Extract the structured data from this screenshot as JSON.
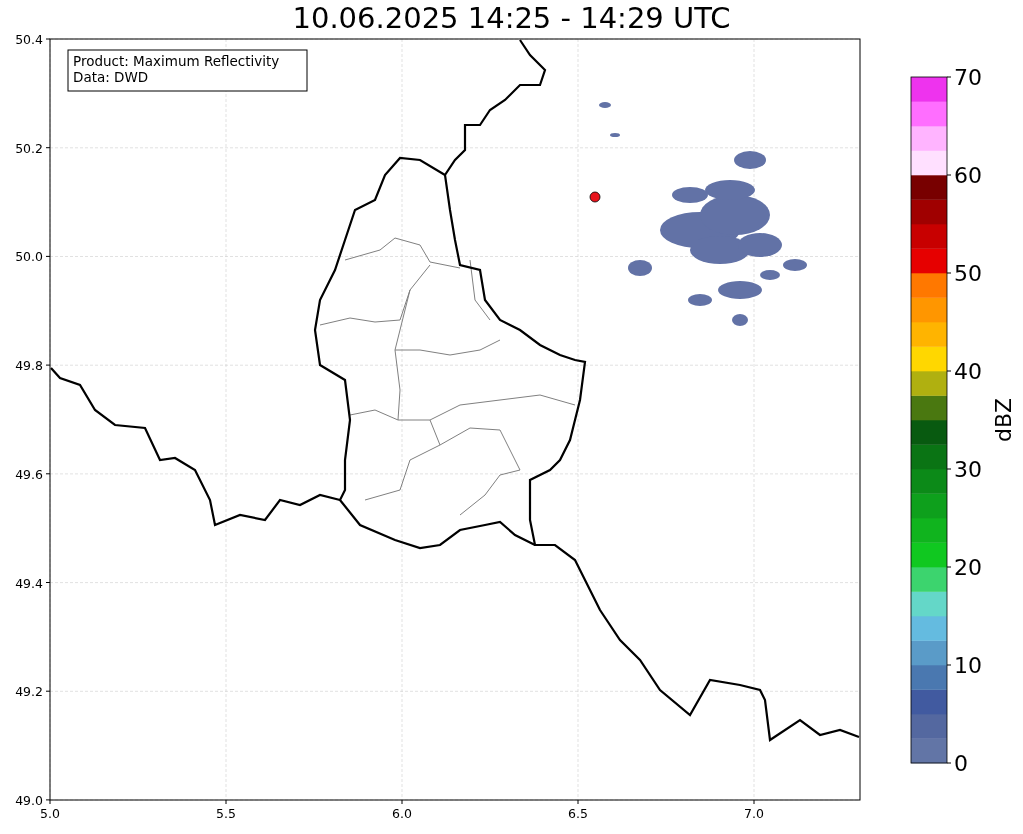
{
  "title": "10.06.2025 14:25 - 14:29 UTC",
  "info_box": {
    "lines": [
      "Product: Maximum Reflectivity",
      "Data: DWD"
    ]
  },
  "x_axis": {
    "ticks": [
      "5.0",
      "5.5",
      "6.0",
      "6.5",
      "7.0"
    ]
  },
  "y_axis": {
    "ticks": [
      "50.4",
      "50.2",
      "50.0",
      "49.8",
      "49.6",
      "49.4",
      "49.2",
      "49.0"
    ]
  },
  "colorbar": {
    "label": "dBZ",
    "ticks": [
      "70",
      "60",
      "50",
      "40",
      "30",
      "20",
      "10",
      "0"
    ],
    "bands": [
      {
        "color": "#6275a6"
      },
      {
        "color": "#5468a0"
      },
      {
        "color": "#415aa0"
      },
      {
        "color": "#4a78b0"
      },
      {
        "color": "#5a9bc8"
      },
      {
        "color": "#64bbe0"
      },
      {
        "color": "#64d7c8"
      },
      {
        "color": "#3cd46e"
      },
      {
        "color": "#10c820"
      },
      {
        "color": "#10b41e"
      },
      {
        "color": "#0ea01c"
      },
      {
        "color": "#0c8a18"
      },
      {
        "color": "#0a7414"
      },
      {
        "color": "#085a10"
      },
      {
        "color": "#4a7810"
      },
      {
        "color": "#b0b010"
      },
      {
        "color": "#ffd700"
      },
      {
        "color": "#ffb400"
      },
      {
        "color": "#ff9600"
      },
      {
        "color": "#ff7800"
      },
      {
        "color": "#e60000"
      },
      {
        "color": "#c80000"
      },
      {
        "color": "#a00000"
      },
      {
        "color": "#780000"
      },
      {
        "color": "#ffe0ff"
      },
      {
        "color": "#ffb4ff"
      },
      {
        "color": "#ff6eff"
      },
      {
        "color": "#ee33ee"
      }
    ]
  }
}
